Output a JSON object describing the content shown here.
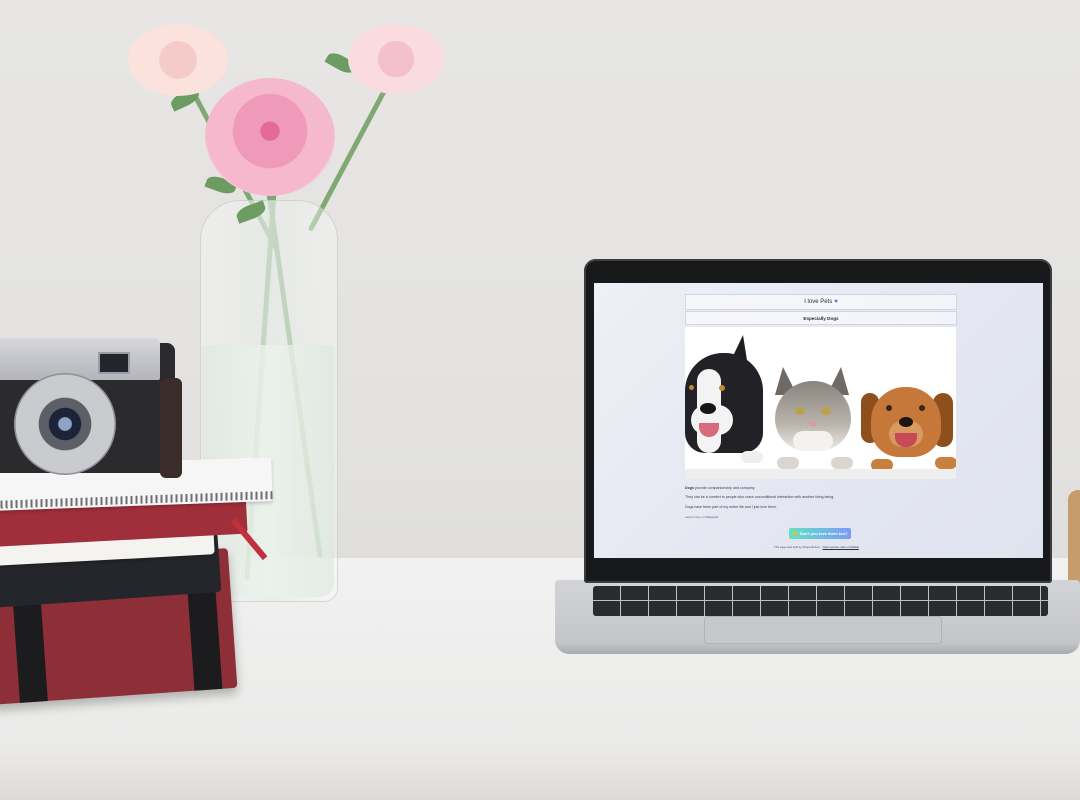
{
  "laptop_site": {
    "header_title": "I love Pets",
    "heart_icon": "purple-heart-icon",
    "subtitle": "Especially Dogs",
    "photo_alt": "dog-cat-dog-icon",
    "paragraph_1_strong": "Dogs",
    "paragraph_1_rest": " provide companionship and company.",
    "paragraph_2": "They can be a comfort to people who crave unconditional interaction with another living being.",
    "paragraph_3": "Dogs have been part of my entire life and I just love them.",
    "learn_more": "Learn more on Wikipedia",
    "cta_emoji": "🙂",
    "cta_label": "Don't you love them too?",
    "footer_text": "This page was built by Shaya Reboa",
    "footer_link": "Open-source code on GitHub"
  },
  "colors": {
    "accent_purple": "#6b5bd3",
    "cta_gradient_start": "#62e0c8",
    "cta_gradient_end": "#7d9bf5"
  }
}
